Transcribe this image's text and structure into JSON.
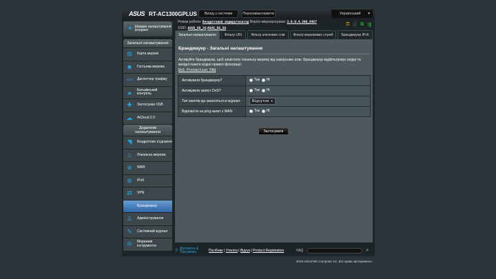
{
  "header": {
    "brand": "ASUS",
    "model": "RT-AC1300GPLUS",
    "logout": "Вихід з системи",
    "reboot": "Перезавантажити",
    "language": "Український"
  },
  "info": {
    "mode_label": "Режим роботи:",
    "mode": "Бездротовий маршрутизатор",
    "fw_label": "Версія мікропрограми:",
    "fw": "3.0.0.4.380_8457",
    "ssid_label": "SSID:",
    "ssid1": "ASUS_68_2G",
    "ssid2": "ASUS_68_5G"
  },
  "sidebar": {
    "qis": "Швидке налаштування Інтернет",
    "general_title": "Загальні налаштування",
    "general": [
      {
        "label": "Карта мережі",
        "icon": "network-map-icon"
      },
      {
        "label": "Гостьова мережа",
        "icon": "guest-network-icon"
      },
      {
        "label": "Диспетчер трафіку",
        "icon": "traffic-icon"
      },
      {
        "label": "Батьківський контроль",
        "icon": "lock-icon"
      },
      {
        "label": "Застосунки USB",
        "icon": "puzzle-icon"
      },
      {
        "label": "AiCloud 2.0",
        "icon": "cloud-icon"
      }
    ],
    "advanced_title": "Додаткові налаштування",
    "advanced": [
      {
        "label": "Бездротове з'єднання",
        "icon": "wifi-icon"
      },
      {
        "label": "Локальна мережа",
        "icon": "home-icon"
      },
      {
        "label": "WAN",
        "icon": "globe-icon"
      },
      {
        "label": "IPv6",
        "icon": "ipv6-icon"
      },
      {
        "label": "VPN",
        "icon": "vpn-icon"
      },
      {
        "label": "Брандмауер",
        "icon": "shield-icon"
      },
      {
        "label": "Адміністрування",
        "icon": "admin-icon"
      },
      {
        "label": "Системний журнал",
        "icon": "log-icon"
      },
      {
        "label": "Мережеві інструменти",
        "icon": "tools-icon"
      }
    ]
  },
  "tabs": [
    "Загальні налаштування",
    "Фільтр URL",
    "Фільтр ключових слів",
    "Фільтр мережевих служб",
    "Брандмауер IPv6"
  ],
  "main": {
    "title": "Брандмауер - Загальні налаштування",
    "description": "Активуйте брандмауер, щоб захистити локальну мережу від хакерських атак. Брандмауер відфільтровує вхідні та вихідні пакети згідно правил фільтрації.",
    "faq_link": "DoS Protection FAQ",
    "yes": "Так",
    "no": "Ні",
    "rows": [
      {
        "label": "Активувати брандмауер?",
        "value": "yes"
      },
      {
        "label": "Активувати захист DoS?",
        "value": "no"
      },
      {
        "label": "Тип пакетів що заносяться в журнал:",
        "select": "Відсутня"
      },
      {
        "label": "Відповісти на ping-запит з WAN",
        "value": "no"
      }
    ],
    "apply": "Застосувати"
  },
  "footer": {
    "help": "Допомога & Підтримка",
    "links": [
      "Посібник",
      "Утиліта",
      "Відгук",
      "Product Registration"
    ],
    "faq": "FAQ",
    "copyright": "2019 ASUSTeK Computer Inc. Всі права застережено."
  }
}
